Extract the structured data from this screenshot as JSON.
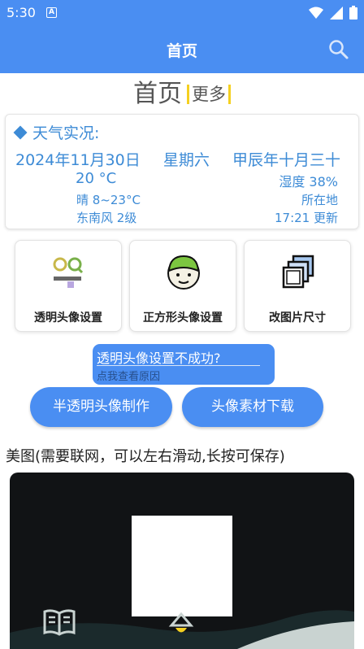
{
  "status_bar": {
    "time": "5:30",
    "sim_label": "A"
  },
  "app_bar": {
    "title": "首页"
  },
  "page_header": {
    "main": "首页",
    "more": "更多"
  },
  "weather": {
    "heading": "天气实况:",
    "date": "2024年11月30日",
    "weekday": "星期六",
    "lunar": "甲辰年十月三十",
    "temperature": "20 °C",
    "humidity": "湿度 38%",
    "condition_range": "晴 8~23°C",
    "location": "所在地",
    "wind": "东南风 2级",
    "updated": "17:21 更新"
  },
  "cards": [
    {
      "label": "透明头像设置",
      "icon": "qq-logo-icon"
    },
    {
      "label": "正方形头像设置",
      "icon": "cartoon-avatar-icon"
    },
    {
      "label": "改图片尺寸",
      "icon": "resize-images-icon"
    }
  ],
  "fail_notice": {
    "title": "透明头像设置不成功?",
    "link": "点我查看原因"
  },
  "buttons": {
    "semi_transparent": "半透明头像制作",
    "materials": "头像素材下载"
  },
  "gallery": {
    "title": "美图(需要联网，可以左右滑动,长按可保存)"
  },
  "colors": {
    "primary": "#4a8ef2",
    "weather_text": "#3d8bd6",
    "accent": "#f5d020"
  }
}
